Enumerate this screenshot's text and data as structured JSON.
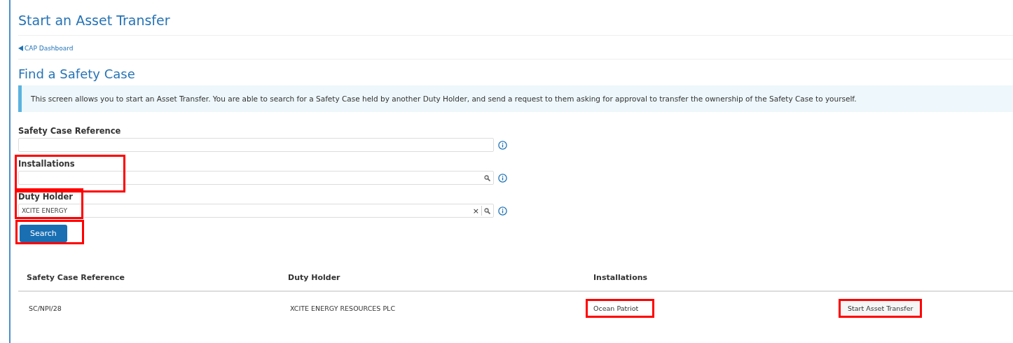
{
  "page": {
    "title": "Start an Asset Transfer",
    "back_link": "CAP Dashboard"
  },
  "section": {
    "title": "Find a Safety Case",
    "info": "This screen allows you to start an Asset Transfer. You are able to search for a Safety Case held by another Duty Holder, and send a request to them asking for approval to transfer the ownership of the Safety Case to yourself."
  },
  "fields": [
    {
      "label": "Safety Case Reference",
      "kind": "text",
      "highlighted": false
    },
    {
      "label": "Installations",
      "kind": "lookup",
      "highlighted": true
    },
    {
      "label": "Duty Holder",
      "kind": "lookup",
      "value": "XCITE ENERGY",
      "clear_icon": "×",
      "highlighted": true
    }
  ],
  "search_button": {
    "label": "Search",
    "highlighted": true
  },
  "table": {
    "columns": [
      "Safety Case Reference",
      "Duty Holder",
      "Installations"
    ],
    "rows": [
      {
        "cells": [
          {
            "text": "SC/NPI/28",
            "highlighted": false
          },
          {
            "text": "XCITE ENERGY RESOURCES PLC",
            "highlighted": false
          },
          {
            "text": "Ocean Patriot",
            "highlighted": true
          }
        ],
        "action": "Start Asset Transfer",
        "action_highlighted": true
      }
    ]
  }
}
